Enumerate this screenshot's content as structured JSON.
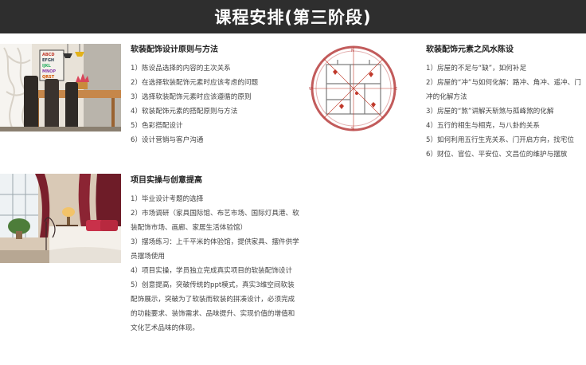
{
  "header": {
    "title": "课程安排(第三阶段)"
  },
  "sections": [
    {
      "title": "软装配饰设计原则与方法",
      "items": [
        "1）陈设品选择的内容的主次关系",
        "2）在选择软装配饰元素时应该考虑的问题",
        "3）选择软装配饰元素时应该遵循的原则",
        "4）软装配饰元素的搭配原则与方法",
        "5）色彩搭配设计",
        "6）设计营销与客户沟通"
      ]
    },
    {
      "title": "软装配饰元素之风水陈设",
      "items": [
        "1）房屋的不足与“缺”，如何补足",
        "2）房屋的“冲”与如何化解：路冲、角冲、遥冲、门冲的化解方法",
        "3）房屋的“煞”讲解天斩煞与孤峰煞的化解",
        "4）五行的相生与相克，与八卦的关系",
        "5）如何利用五行生克关系、门开启方向，找宅位",
        "6）财位、官位、平安位、文昌位的维护与摆放"
      ]
    },
    {
      "title": "项目实操与创意提高",
      "items": [
        "1）毕业设计考题的选择",
        "2）市场调研（家具国际馆、布艺市场、国际灯具港、软装配饰市场、画廊、家居生活体验馆）",
        "3）摆场练习：上千平米的体验馆，提供家具、摆件供学员摆场使用",
        "4）项目实操，学员独立完成真实项目的软装配饰设计",
        "5）创意提高，突破传统的ppt模式，真实3维空间软装配饰展示，突破为了软装而软装的拼凑设计，必须完成的功能要求、装饰需求、品味提升、实现价值的增值和文化艺术品味的体现。"
      ]
    }
  ],
  "images": {
    "dining": {
      "poster_letters": "ABCDEFGHIJKLMNOPQRSTUVWXYZ"
    }
  }
}
